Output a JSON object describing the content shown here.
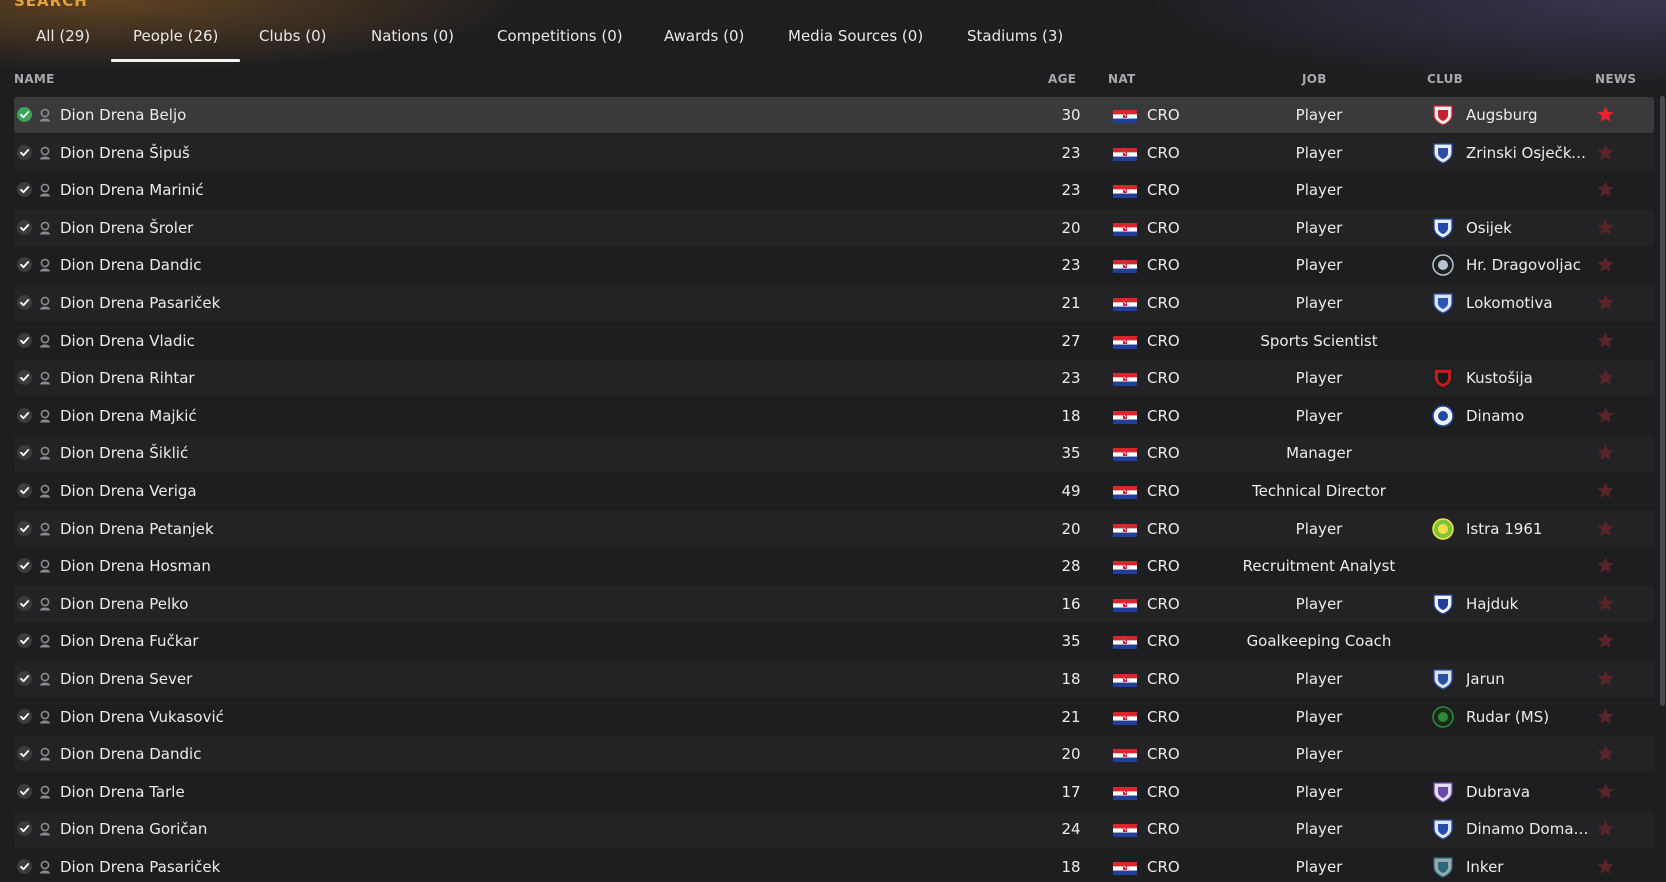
{
  "heading": "SEARCH",
  "tabs": [
    {
      "label": "All (29)"
    },
    {
      "label": "People (26)"
    },
    {
      "label": "Clubs (0)"
    },
    {
      "label": "Nations (0)"
    },
    {
      "label": "Competitions (0)"
    },
    {
      "label": "Awards (0)"
    },
    {
      "label": "Media Sources (0)"
    },
    {
      "label": "Stadiums (3)"
    }
  ],
  "active_tab": "People (26)",
  "columns": {
    "name": "NAME",
    "age": "AGE",
    "nat": "NAT",
    "job": "JOB",
    "club": "CLUB",
    "news": "NEWS"
  },
  "colors": {
    "accent": "#e2a23a",
    "star_active": "#e8222e",
    "star_inactive": "#5a2428",
    "selected": "#3aa55a"
  },
  "rows": [
    {
      "name": "Dion Drena Beljo",
      "age": "30",
      "nat": "CRO",
      "job": "Player",
      "club": "Augsburg",
      "crest": "augsburg",
      "selected": true,
      "news": true
    },
    {
      "name": "Dion Drena Šipuš",
      "age": "23",
      "nat": "CRO",
      "job": "Player",
      "club": "Zrinski Osječko...",
      "crest": "zrinski"
    },
    {
      "name": "Dion Drena Marinić",
      "age": "23",
      "nat": "CRO",
      "job": "Player",
      "club": "",
      "crest": ""
    },
    {
      "name": "Dion Drena Šroler",
      "age": "20",
      "nat": "CRO",
      "job": "Player",
      "club": "Osijek",
      "crest": "osijek"
    },
    {
      "name": "Dion Drena Dandic",
      "age": "23",
      "nat": "CRO",
      "job": "Player",
      "club": "Hr. Dragovoljac",
      "crest": "dragovoljac"
    },
    {
      "name": "Dion Drena Pasariček",
      "age": "21",
      "nat": "CRO",
      "job": "Player",
      "club": "Lokomotiva",
      "crest": "lokomotiva"
    },
    {
      "name": "Dion Drena Vladic",
      "age": "27",
      "nat": "CRO",
      "job": "Sports Scientist",
      "club": "",
      "crest": ""
    },
    {
      "name": "Dion Drena Rihtar",
      "age": "23",
      "nat": "CRO",
      "job": "Player",
      "club": "Kustošija",
      "crest": "kustosija"
    },
    {
      "name": "Dion Drena Majkić",
      "age": "18",
      "nat": "CRO",
      "job": "Player",
      "club": "Dinamo",
      "crest": "dinamo"
    },
    {
      "name": "Dion Drena Šiklić",
      "age": "35",
      "nat": "CRO",
      "job": "Manager",
      "club": "",
      "crest": ""
    },
    {
      "name": "Dion Drena Veriga",
      "age": "49",
      "nat": "CRO",
      "job": "Technical Director",
      "club": "",
      "crest": ""
    },
    {
      "name": "Dion Drena Petanjek",
      "age": "20",
      "nat": "CRO",
      "job": "Player",
      "club": "Istra 1961",
      "crest": "istra"
    },
    {
      "name": "Dion Drena Hosman",
      "age": "28",
      "nat": "CRO",
      "job": "Recruitment Analyst",
      "club": "",
      "crest": ""
    },
    {
      "name": "Dion Drena Pelko",
      "age": "16",
      "nat": "CRO",
      "job": "Player",
      "club": "Hajduk",
      "crest": "hajduk"
    },
    {
      "name": "Dion Drena Fučkar",
      "age": "35",
      "nat": "CRO",
      "job": "Goalkeeping Coach",
      "club": "",
      "crest": ""
    },
    {
      "name": "Dion Drena Sever",
      "age": "18",
      "nat": "CRO",
      "job": "Player",
      "club": "Jarun",
      "crest": "jarun"
    },
    {
      "name": "Dion Drena Vukasović",
      "age": "21",
      "nat": "CRO",
      "job": "Player",
      "club": "Rudar (MS)",
      "crest": "rudar"
    },
    {
      "name": "Dion Drena Dandic",
      "age": "20",
      "nat": "CRO",
      "job": "Player",
      "club": "",
      "crest": ""
    },
    {
      "name": "Dion Drena Tarle",
      "age": "17",
      "nat": "CRO",
      "job": "Player",
      "club": "Dubrava",
      "crest": "dubrava"
    },
    {
      "name": "Dion Drena Goričan",
      "age": "24",
      "nat": "CRO",
      "job": "Player",
      "club": "Dinamo Domaš...",
      "crest": "domasinec"
    },
    {
      "name": "Dion Drena Pasariček",
      "age": "18",
      "nat": "CRO",
      "job": "Player",
      "club": "Inker",
      "crest": "inker"
    }
  ]
}
